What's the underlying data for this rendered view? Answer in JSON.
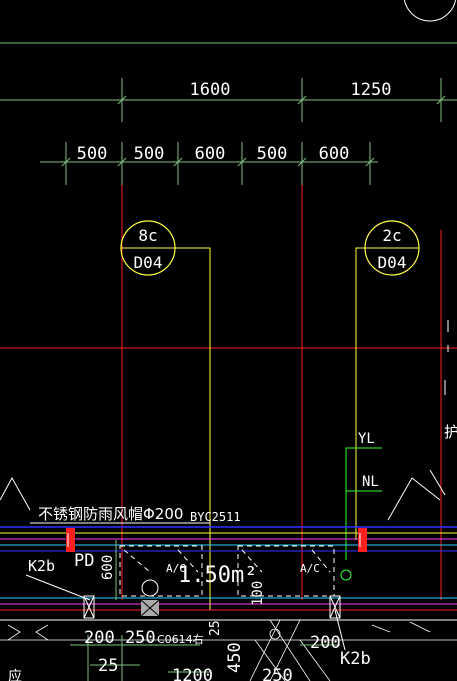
{
  "colors": {
    "background": "#000000",
    "dimension": "#7fbf7f",
    "axis": "#ff2020",
    "text": "#ffffff",
    "yellow": "#ffff40",
    "blue": "#3030ff",
    "cyan": "#30d0ff",
    "magenta": "#ff40ff"
  },
  "dimensions": {
    "top": [
      "1600",
      "1250"
    ],
    "second": [
      "500",
      "500",
      "600",
      "500",
      "600"
    ]
  },
  "callouts": [
    {
      "number": "8c",
      "sheet": "D04"
    },
    {
      "number": "2c",
      "sheet": "D04"
    }
  ],
  "labels": {
    "yl": "YL",
    "nl": "NL",
    "cap_note": "不锈钢防雨风帽Φ200",
    "by_tag": "BYC2511",
    "pd": "PD",
    "k2b_left": "K2b",
    "k2b_right": "K2b",
    "area": "1.50m²",
    "ac_left": "A/C",
    "ac_right": "A/C",
    "dim_600_vertical": "600",
    "dim_100_vertical": "100",
    "dim_25": "25",
    "dim_200_250": "200 250",
    "window_tag": "C0614右",
    "dim_200_right": "200",
    "dim_25_bottom": "25",
    "dim_1200": "1200",
    "dim_450": "450",
    "dim_250": "250",
    "edge_char": "护",
    "bottom_left_char": "应"
  }
}
